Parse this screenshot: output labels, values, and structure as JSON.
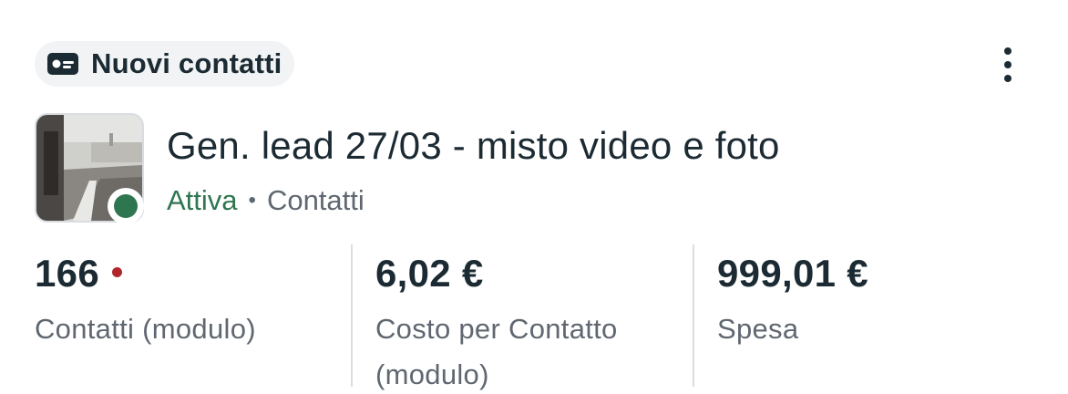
{
  "badge": {
    "icon": "contact-card-icon",
    "label": "Nuovi contatti"
  },
  "menu": {
    "icon": "more-vertical-icon"
  },
  "ad": {
    "thumbnail": "kitchen-photo-thumbnail",
    "title": "Gen. lead 27/03 - misto video e foto",
    "status": "Attiva",
    "separator": "•",
    "type": "Contatti",
    "status_color": "#2e7650"
  },
  "metrics": [
    {
      "value": "166",
      "label": "Contatti (modulo)",
      "alert": true,
      "alert_color": "#b1262b"
    },
    {
      "value": "6,02 €",
      "label": "Costo per Contatto (modulo)"
    },
    {
      "value": "999,01 €",
      "label": "Spesa"
    }
  ]
}
